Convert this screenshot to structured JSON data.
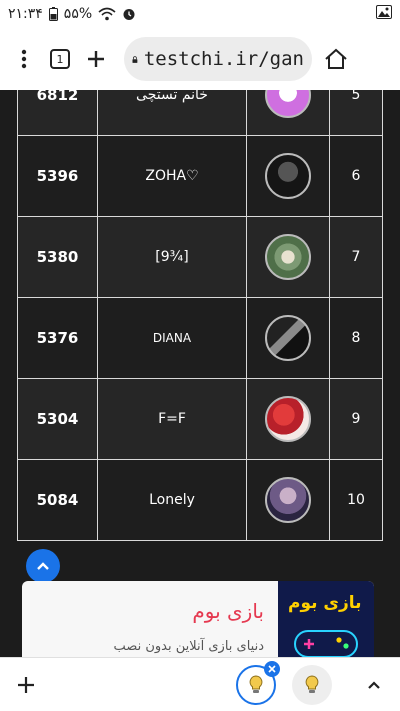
{
  "status_bar": {
    "time": "۲۱:۳۴",
    "battery": "۵۵%"
  },
  "browser": {
    "tab_count": "1",
    "url": "testchi.ir/gan"
  },
  "leaderboard": [
    {
      "rank": "5",
      "name": "خانم تستچی",
      "score": "6812"
    },
    {
      "rank": "6",
      "name": "ZOHA♡",
      "score": "5396"
    },
    {
      "rank": "7",
      "name": "[9¾]",
      "score": "5380"
    },
    {
      "rank": "8",
      "name": "DIANA",
      "score": "5376"
    },
    {
      "rank": "9",
      "name": "F=F",
      "score": "5304"
    },
    {
      "rank": "10",
      "name": "Lonely",
      "score": "5084"
    }
  ],
  "ad": {
    "title": "بازی بوم",
    "description": "دنیای بازی آنلاین بدون نصب",
    "image_title": "بازی بوم"
  },
  "colors": {
    "accent": "#1a73e8",
    "ad_title": "#e53950"
  }
}
